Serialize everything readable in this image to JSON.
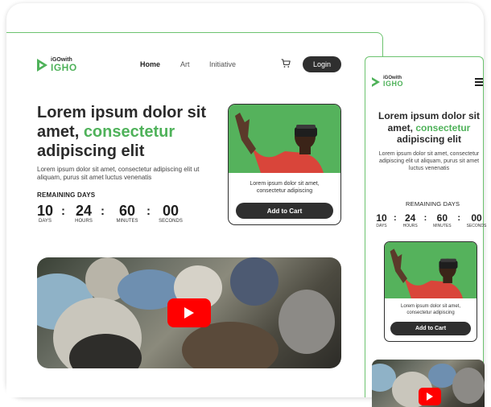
{
  "brand": {
    "line1": "iGOwith",
    "line2": "IGHO"
  },
  "nav": {
    "items": [
      "Home",
      "Art",
      "Initiative"
    ],
    "login": "Login"
  },
  "hero": {
    "title_part1": "Lorem ipsum dolor sit amet,",
    "title_highlight": "consectetur",
    "title_part2": "adipiscing elit",
    "subtitle": "Lorem ipsum dolor sit amet, consectetur adipiscing elit ut aliquam, purus sit amet luctus venenatis"
  },
  "countdown": {
    "label": "REMAINING DAYS",
    "units": [
      {
        "value": "10",
        "label": "DAYS"
      },
      {
        "value": "24",
        "label": "HOURS"
      },
      {
        "value": "60",
        "label": "MINUTES"
      },
      {
        "value": "00",
        "label": "SECONDS"
      }
    ],
    "separator": ":"
  },
  "product": {
    "description": "Lorem ipsum dolor sit amet, consectetur adipiscing",
    "button": "Add to Cart"
  },
  "colors": {
    "accent": "#4fb25a",
    "dark": "#2f2f2f",
    "youtube": "#ff0000"
  },
  "icons": [
    "logo-icon",
    "cart-icon",
    "play-icon",
    "menu-icon"
  ]
}
